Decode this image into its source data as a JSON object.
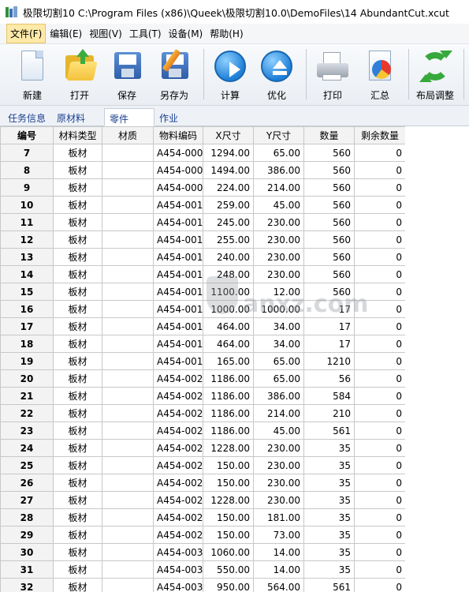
{
  "window": {
    "title": "极限切割10 C:\\Program Files (x86)\\Queek\\极限切割10.0\\DemoFiles\\14 AbundantCut.xcut"
  },
  "menu": {
    "items": [
      "文件(F)",
      "编辑(E)",
      "视图(V)",
      "工具(T)",
      "设备(M)",
      "帮助(H)"
    ]
  },
  "toolbar": {
    "new_label": "新建",
    "open_label": "打开",
    "save_label": "保存",
    "saveas_label": "另存为",
    "calc_label": "计算",
    "optimize_label": "优化",
    "print_label": "打印",
    "summary_label": "汇总",
    "layout_label": "布局调整"
  },
  "tabs": {
    "items": [
      "任务信息",
      "原材料",
      "零件",
      "作业"
    ],
    "active": "零件"
  },
  "table": {
    "headers": [
      "编号",
      "材料类型",
      "材质",
      "物料编码",
      "X尺寸",
      "Y尺寸",
      "数量",
      "剩余数量"
    ],
    "rows": [
      [
        "7",
        "板材",
        "",
        "A454-000",
        "1294.00",
        "65.00",
        "560",
        "0"
      ],
      [
        "8",
        "板材",
        "",
        "A454-000",
        "1494.00",
        "386.00",
        "560",
        "0"
      ],
      [
        "9",
        "板材",
        "",
        "A454-000",
        "224.00",
        "214.00",
        "560",
        "0"
      ],
      [
        "10",
        "板材",
        "",
        "A454-001",
        "259.00",
        "45.00",
        "560",
        "0"
      ],
      [
        "11",
        "板材",
        "",
        "A454-001",
        "245.00",
        "230.00",
        "560",
        "0"
      ],
      [
        "12",
        "板材",
        "",
        "A454-001",
        "255.00",
        "230.00",
        "560",
        "0"
      ],
      [
        "13",
        "板材",
        "",
        "A454-001",
        "240.00",
        "230.00",
        "560",
        "0"
      ],
      [
        "14",
        "板材",
        "",
        "A454-001",
        "248.00",
        "230.00",
        "560",
        "0"
      ],
      [
        "15",
        "板材",
        "",
        "A454-001",
        "1100.00",
        "12.00",
        "560",
        "0"
      ],
      [
        "16",
        "板材",
        "",
        "A454-001",
        "1000.00",
        "1000.00",
        "17",
        "0"
      ],
      [
        "17",
        "板材",
        "",
        "A454-001",
        "464.00",
        "34.00",
        "17",
        "0"
      ],
      [
        "18",
        "板材",
        "",
        "A454-001",
        "464.00",
        "34.00",
        "17",
        "0"
      ],
      [
        "19",
        "板材",
        "",
        "A454-001",
        "165.00",
        "65.00",
        "1210",
        "0"
      ],
      [
        "20",
        "板材",
        "",
        "A454-002",
        "1186.00",
        "65.00",
        "56",
        "0"
      ],
      [
        "21",
        "板材",
        "",
        "A454-002",
        "1186.00",
        "386.00",
        "584",
        "0"
      ],
      [
        "22",
        "板材",
        "",
        "A454-002",
        "1186.00",
        "214.00",
        "210",
        "0"
      ],
      [
        "23",
        "板材",
        "",
        "A454-002",
        "1186.00",
        "45.00",
        "561",
        "0"
      ],
      [
        "24",
        "板材",
        "",
        "A454-002",
        "1228.00",
        "230.00",
        "35",
        "0"
      ],
      [
        "25",
        "板材",
        "",
        "A454-002",
        "150.00",
        "230.00",
        "35",
        "0"
      ],
      [
        "26",
        "板材",
        "",
        "A454-002",
        "150.00",
        "230.00",
        "35",
        "0"
      ],
      [
        "27",
        "板材",
        "",
        "A454-002",
        "1228.00",
        "230.00",
        "35",
        "0"
      ],
      [
        "28",
        "板材",
        "",
        "A454-002",
        "150.00",
        "181.00",
        "35",
        "0"
      ],
      [
        "29",
        "板材",
        "",
        "A454-002",
        "150.00",
        "73.00",
        "35",
        "0"
      ],
      [
        "30",
        "板材",
        "",
        "A454-003",
        "1060.00",
        "14.00",
        "35",
        "0"
      ],
      [
        "31",
        "板材",
        "",
        "A454-003",
        "550.00",
        "14.00",
        "35",
        "0"
      ],
      [
        "32",
        "板材",
        "",
        "A454-003",
        "950.00",
        "564.00",
        "561",
        "0"
      ]
    ]
  },
  "watermark": {
    "text": "anxz.com"
  }
}
